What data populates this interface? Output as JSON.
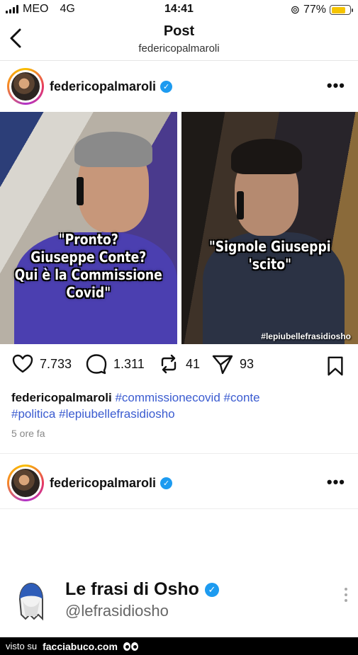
{
  "status_bar": {
    "carrier": "MEO",
    "network": "4G",
    "time": "14:41",
    "battery": "77%",
    "battery_level": 0.77
  },
  "nav": {
    "title": "Post",
    "subtitle": "federicopalmaroli"
  },
  "post": {
    "username": "federicopalmaroli",
    "image_left_caption": "\"Pronto?\nGiuseppe Conte?\nQui è la Commissione\nCovid\"",
    "image_right_caption": "\"Signole Giuseppi\n'scito\"",
    "watermark": "#lepiubellefrasidiosho",
    "likes": "7.733",
    "comments": "1.311",
    "reposts": "41",
    "shares": "93",
    "caption_user": "federicopalmaroli",
    "hashtags": [
      "#commissionecovid",
      "#conte",
      "#politica",
      "#lepiubellefrasidiosho"
    ],
    "time_ago": "5 ore fa"
  },
  "post2": {
    "username": "federicopalmaroli"
  },
  "embed": {
    "name": "Le frasi di Osho",
    "handle": "@lefrasidiosho"
  },
  "footer": {
    "prefix": "visto su",
    "site": "facciabuco.com"
  },
  "icons": {
    "back": "chevron-left-icon",
    "verified": "verified-badge-icon",
    "more": "more-horizontal-icon",
    "like": "heart-icon",
    "comment": "comment-icon",
    "repost": "repost-icon",
    "share": "send-icon",
    "save": "bookmark-icon"
  },
  "colors": {
    "link": "#3a5bd0",
    "verified": "#1d9bf0",
    "battery": "#f5c400"
  }
}
